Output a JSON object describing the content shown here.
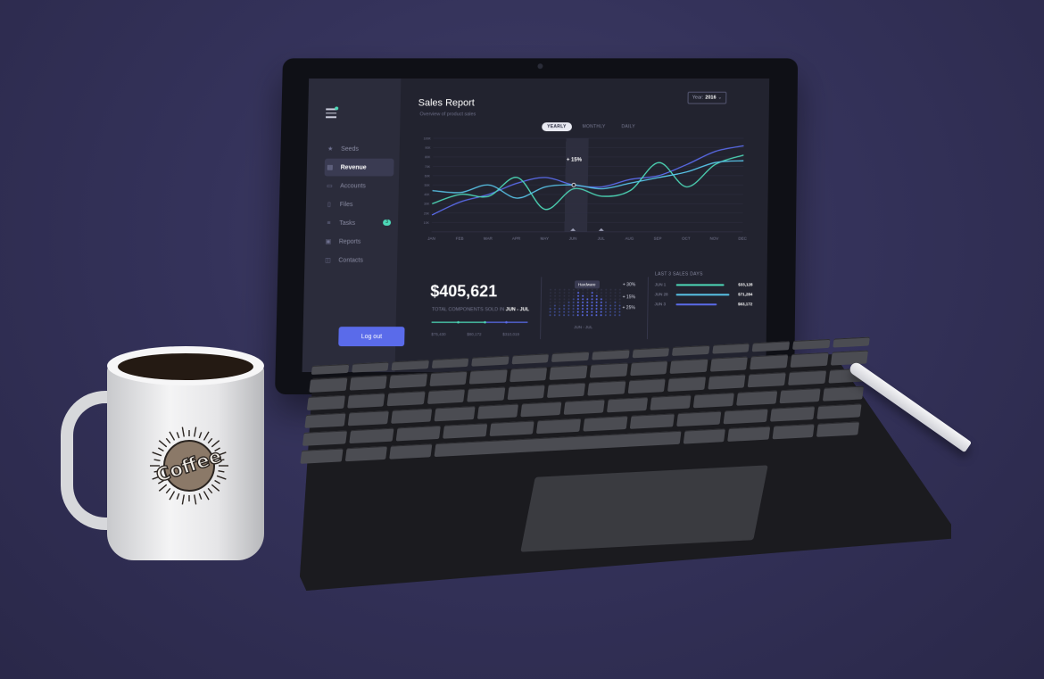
{
  "app": {
    "title": "Sales Report",
    "subtitle": "Overview of product sales",
    "year": {
      "label": "Year:",
      "value": "2016"
    }
  },
  "sidebar": {
    "items": [
      {
        "label": "Seeds",
        "icon": "star-icon",
        "active": false
      },
      {
        "label": "Revenue",
        "icon": "bar-chart-icon",
        "active": true
      },
      {
        "label": "Accounts",
        "icon": "card-icon",
        "active": false
      },
      {
        "label": "Files",
        "icon": "file-icon",
        "active": false
      },
      {
        "label": "Tasks",
        "icon": "list-icon",
        "active": false,
        "badge": "3"
      },
      {
        "label": "Reports",
        "icon": "clipboard-icon",
        "active": false
      },
      {
        "label": "Contacts",
        "icon": "contact-icon",
        "active": false
      }
    ],
    "logout_label": "Log out"
  },
  "tabs": [
    "YEARLY",
    "MONTHLY",
    "DAILY"
  ],
  "stats": {
    "total_value": "$405,621",
    "total_label": "TOTAL COMPONENTS SOLD IN",
    "total_period": "JUN - JUL",
    "mini_labels": [
      "$75,430",
      "$80,172",
      "$310,019"
    ],
    "hardware_label": "Hardware",
    "hardware_date": "JUN - JUL",
    "percents": [
      "+ 30%",
      "+ 15%",
      "+ 25%"
    ],
    "last3_title": "LAST 3 SALES DAYS",
    "last3": [
      {
        "date": "JUN 1",
        "value": "$33,128"
      },
      {
        "date": "JUN 28",
        "value": "$71,284"
      },
      {
        "date": "JUN 3",
        "value": "$63,172"
      }
    ]
  },
  "mug": {
    "text": "Coffee"
  },
  "colors": {
    "blue": "#5a6bea",
    "teal": "#4dd9b8",
    "cyan": "#58c4e8",
    "bg": "#22232f"
  },
  "chart_data": {
    "type": "line",
    "x": [
      "JAN",
      "FEB",
      "MAR",
      "APR",
      "MAY",
      "JUN",
      "JUL",
      "AUG",
      "SEP",
      "OCT",
      "NOV",
      "DEC"
    ],
    "y_ticks": [
      "10K",
      "20K",
      "30K",
      "40K",
      "50K",
      "60K",
      "70K",
      "80K",
      "90K",
      "100K"
    ],
    "ylim": [
      0,
      100
    ],
    "highlight": {
      "category": "JUN",
      "label": "+ 15%"
    },
    "series": [
      {
        "color": "#5a6bea",
        "values": [
          18,
          32,
          40,
          52,
          58,
          50,
          48,
          56,
          60,
          72,
          86,
          92
        ]
      },
      {
        "color": "#4dd9b8",
        "values": [
          30,
          40,
          38,
          58,
          24,
          46,
          38,
          44,
          74,
          48,
          72,
          82
        ]
      },
      {
        "color": "#58c4e8",
        "values": [
          44,
          42,
          50,
          36,
          48,
          50,
          46,
          52,
          58,
          64,
          74,
          76
        ]
      }
    ]
  }
}
